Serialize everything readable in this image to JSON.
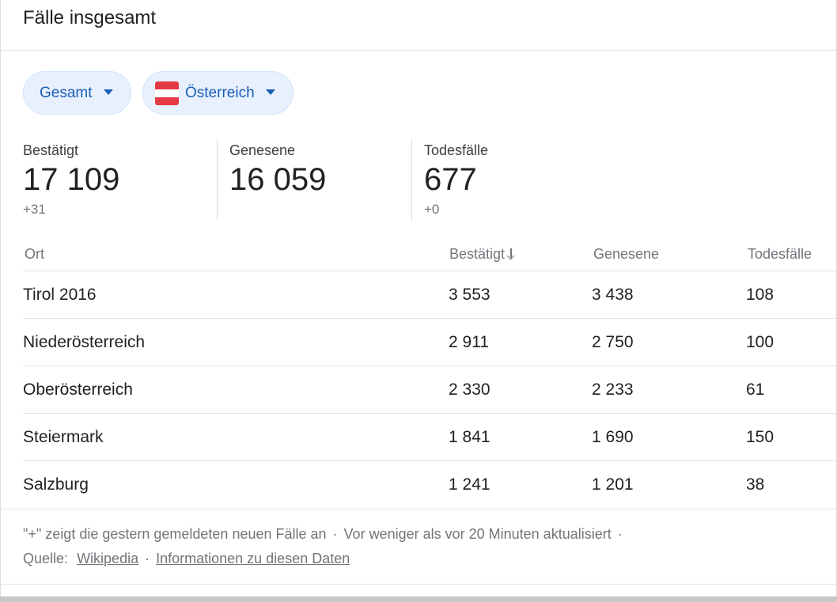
{
  "header": {
    "title": "Fälle insgesamt"
  },
  "filters": {
    "scope_label": "Gesamt",
    "region_label": "Österreich",
    "flag_icon": "austria-flag-icon",
    "colors": {
      "chip_bg": "#e8f0fe",
      "chip_text": "#1a5fb4",
      "flag_red": "#e53945"
    }
  },
  "stats": [
    {
      "label": "Bestätigt",
      "value": "17 109",
      "delta": "+31"
    },
    {
      "label": "Genesene",
      "value": "16 059",
      "delta": ""
    },
    {
      "label": "Todesfälle",
      "value": "677",
      "delta": "+0"
    }
  ],
  "table": {
    "columns": [
      "Ort",
      "Bestätigt",
      "Genesene",
      "Todesfälle"
    ],
    "sort_icon": "arrow-down-icon",
    "rows": [
      {
        "ort": "Tirol 2016",
        "bestaetigt": "3 553",
        "genesene": "3 438",
        "todesfaelle": "108"
      },
      {
        "ort": "Niederösterreich",
        "bestaetigt": "2 911",
        "genesene": "2 750",
        "todesfaelle": "100"
      },
      {
        "ort": "Oberösterreich",
        "bestaetigt": "2 330",
        "genesene": "2 233",
        "todesfaelle": "61"
      },
      {
        "ort": "Steiermark",
        "bestaetigt": "1 841",
        "genesene": "1 690",
        "todesfaelle": "150"
      },
      {
        "ort": "Salzburg",
        "bestaetigt": "1 241",
        "genesene": "1 201",
        "todesfaelle": "38"
      }
    ]
  },
  "footer": {
    "note": "\"+\" zeigt die gestern gemeldeten neuen Fälle an",
    "updated": "Vor weniger als vor 20 Minuten aktualisiert",
    "separator": "·",
    "source_label": "Quelle:",
    "source_link": "Wikipedia",
    "info_link": "Informationen zu diesen Daten"
  }
}
